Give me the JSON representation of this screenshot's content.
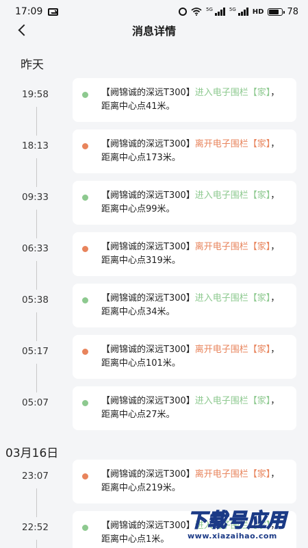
{
  "status_bar": {
    "time": "17:09",
    "battery": "78",
    "hd_label": "HD",
    "signal_tag": "5G",
    "icons": [
      "message-icon",
      "alarm-icon",
      "wifi-icon",
      "signal-icon",
      "signal-icon",
      "battery-icon"
    ]
  },
  "header": {
    "title": "消息详情",
    "back_icon": "chevron-left-icon"
  },
  "sections": [
    {
      "date": "昨天",
      "items": [
        {
          "time": "19:58",
          "device": "【阙锦诚的深远T300】",
          "action": "进入电子围栏",
          "fence": "【家】",
          "rest": "，距离中心点41米。",
          "type": "enter"
        },
        {
          "time": "18:13",
          "device": "【阙锦诚的深远T300】",
          "action": "离开电子围栏",
          "fence": "【家】",
          "rest": "，距离中心点173米。",
          "type": "leave"
        },
        {
          "time": "09:33",
          "device": "【阙锦诚的深远T300】",
          "action": "进入电子围栏",
          "fence": "【家】",
          "rest": "，距离中心点99米。",
          "type": "enter"
        },
        {
          "time": "06:33",
          "device": "【阙锦诚的深远T300】",
          "action": "离开电子围栏",
          "fence": "【家】",
          "rest": "，距离中心点319米。",
          "type": "leave"
        },
        {
          "time": "05:38",
          "device": "【阙锦诚的深远T300】",
          "action": "进入电子围栏",
          "fence": "【家】",
          "rest": "，距离中心点34米。",
          "type": "enter"
        },
        {
          "time": "05:17",
          "device": "【阙锦诚的深远T300】",
          "action": "离开电子围栏",
          "fence": "【家】",
          "rest": "，距离中心点101米。",
          "type": "leave"
        },
        {
          "time": "05:07",
          "device": "【阙锦诚的深远T300】",
          "action": "进入电子围栏",
          "fence": "【家】",
          "rest": "，距离中心点27米。",
          "type": "enter"
        }
      ]
    },
    {
      "date": "03月16日",
      "items": [
        {
          "time": "23:07",
          "device": "【阙锦诚的深远T300】",
          "action": "离开电子围栏",
          "fence": "【家】",
          "rest": "，距离中心点219米。",
          "type": "leave"
        },
        {
          "time": "22:52",
          "device": "【阙锦诚的深远T300】",
          "action": "进入电子围栏",
          "fence": "【家】",
          "rest": "，距离中心点1米。",
          "type": "enter"
        }
      ]
    }
  ],
  "colors": {
    "enter": "#8dc98f",
    "leave": "#e8845c",
    "background": "#f4f5f7",
    "card": "#ffffff"
  },
  "watermark": {
    "main": "下载号应用",
    "url": "www.xiazaihao.com"
  }
}
